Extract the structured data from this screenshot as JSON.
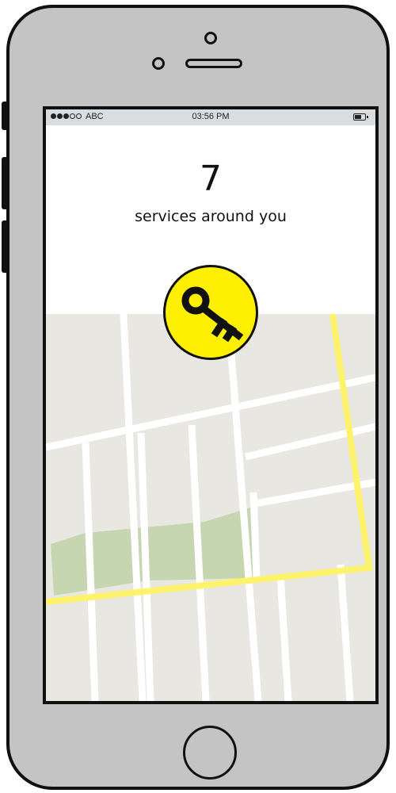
{
  "status_bar": {
    "carrier": "ABC",
    "time": "03:56 PM",
    "signal_bars_filled": 3,
    "signal_bars_total": 5,
    "battery_icon": "battery-icon"
  },
  "main": {
    "count": "7",
    "subtitle": "services around you"
  },
  "key_badge": {
    "icon": "key-icon",
    "color": "#ffef00"
  },
  "map": {
    "icon": "map",
    "colors": {
      "land": "#e9e7e1",
      "street": "#ffffff",
      "main_road": "#fff36e",
      "park": "#c5d6b0"
    }
  },
  "device": {
    "body_color": "#c4c4c4"
  }
}
